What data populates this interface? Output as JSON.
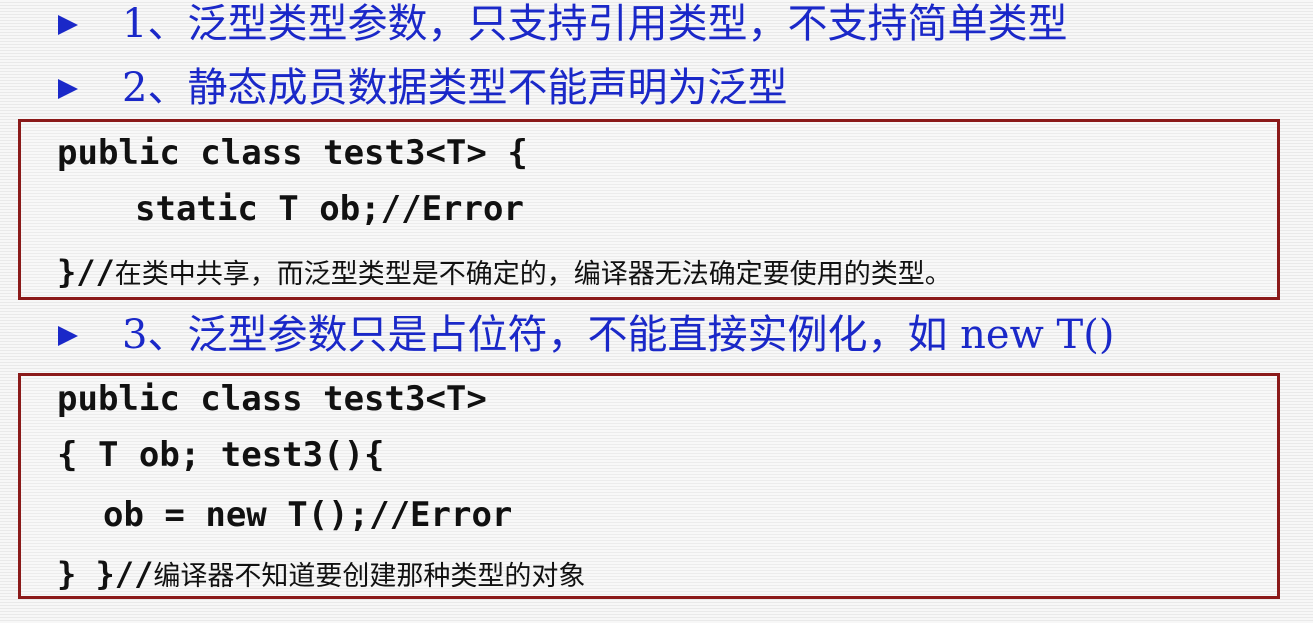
{
  "colors": {
    "bullet_text": "#1a28c8",
    "code_box_border": "#8b1a1a",
    "code_text": "#111111"
  },
  "bullets": [
    {
      "icon": "arrow-icon",
      "text": "1、泛型类型参数，只支持引用类型，不支持简单类型"
    },
    {
      "icon": "arrow-icon",
      "text": "2、静态成员数据类型不能声明为泛型"
    },
    {
      "icon": "arrow-icon",
      "text": "3、泛型参数只是占位符，不能直接实例化，如 new T()"
    }
  ],
  "code_block_1": {
    "line1": "public class test3<T> {",
    "line2": "static T ob;//Error",
    "line3_code": "}",
    "line3_slashes": "//",
    "line3_comment": "在类中共享，而泛型类型是不确定的，编译器无法确定要使用的类型。"
  },
  "code_block_2": {
    "line1": "public class test3<T>",
    "line2": "{ T ob; test3(){",
    "line3": "ob = new T();//Error",
    "line4_code": "} }",
    "line4_slashes": "//",
    "line4_comment": "编译器不知道要创建那种类型的对象"
  }
}
